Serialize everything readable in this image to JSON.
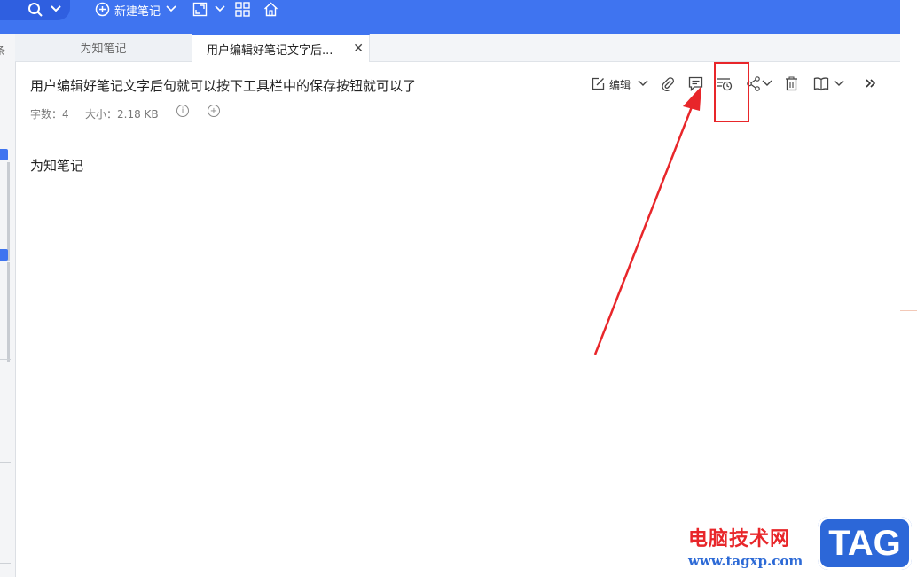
{
  "toolbar": {
    "new_note_label": "新建笔记"
  },
  "tabs": [
    {
      "label": "为知笔记",
      "active": false
    },
    {
      "label": "用户编辑好笔记文字后...",
      "active": true
    }
  ],
  "note": {
    "title": "用户编辑好笔记文字后句就可以按下工具栏中的保存按钮就可以了",
    "word_count_label": "字数：4",
    "size_label": "大小：2.18 KB",
    "body": "为知笔记"
  },
  "note_toolbar": {
    "edit_label": "编辑"
  },
  "sidebar_fragment": "条",
  "watermark": {
    "site_name": "电脑技术网",
    "url": "www.tagxp.com",
    "logo": "TAG"
  },
  "colors": {
    "accent": "#3f74f0",
    "annotation": "#e8262a"
  }
}
